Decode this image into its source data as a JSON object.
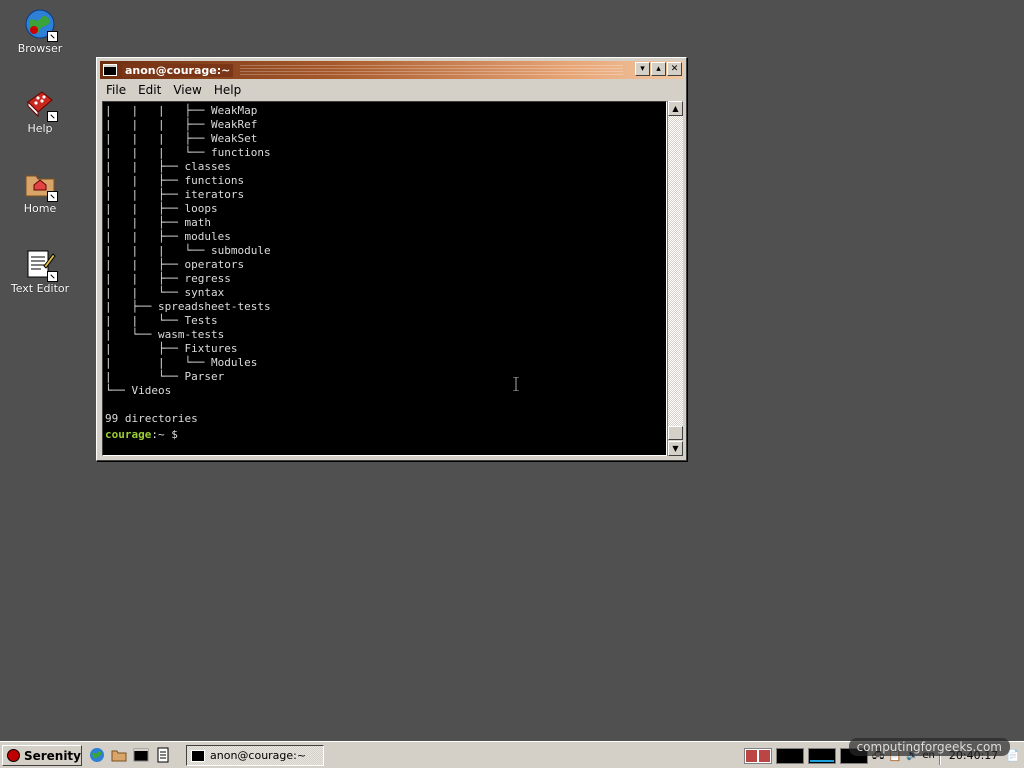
{
  "desktop": {
    "icons": [
      {
        "label": "Browser"
      },
      {
        "label": "Help"
      },
      {
        "label": "Home"
      },
      {
        "label": "Text Editor"
      }
    ]
  },
  "window": {
    "title": "anon@courage:~",
    "buttons": {
      "minimize": "▾",
      "maximize": "▴",
      "close": "✕"
    },
    "menu": [
      "File",
      "Edit",
      "View",
      "Help"
    ]
  },
  "terminal": {
    "lines": [
      "|   |   |   ├── WeakMap",
      "|   |   |   ├── WeakRef",
      "|   |   |   ├── WeakSet",
      "|   |   |   └── functions",
      "|   |   ├── classes",
      "|   |   ├── functions",
      "|   |   ├── iterators",
      "|   |   ├── loops",
      "|   |   ├── math",
      "|   |   ├── modules",
      "|   |   |   └── submodule",
      "|   |   ├── operators",
      "|   |   ├── regress",
      "|   |   └── syntax",
      "|   ├── spreadsheet-tests",
      "|   |   └── Tests",
      "|   └── wasm-tests",
      "|       ├── Fixtures",
      "|       |   └── Modules",
      "|       └── Parser",
      "└── Videos",
      "",
      "99 directories",
      ""
    ],
    "prompt_user": "courage",
    "prompt_rest": ":~ $"
  },
  "taskbar": {
    "start_label": "Serenity",
    "task_label": "anon@courage:~",
    "keyboard_layout": "en",
    "clock": "20:40:17",
    "watermark": "computingforgeeks.com"
  }
}
